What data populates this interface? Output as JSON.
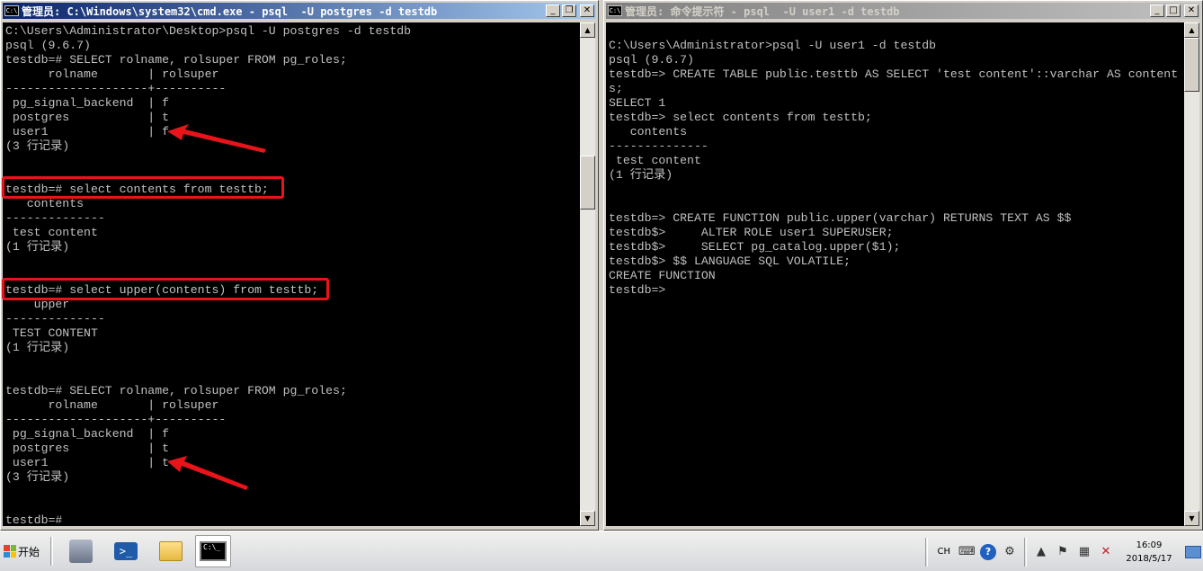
{
  "left_window": {
    "title": "管理员: C:\\Windows\\system32\\cmd.exe - psql  -U postgres -d testdb",
    "icon_text": "C:\\",
    "buttons": {
      "minimize": "_",
      "maximize": "❐",
      "close": "✕"
    },
    "console_text": "C:\\Users\\Administrator\\Desktop>psql -U postgres -d testdb\npsql (9.6.7)\ntestdb=# SELECT rolname, rolsuper FROM pg_roles;\n      rolname       | rolsuper\n--------------------+----------\n pg_signal_backend  | f\n postgres           | t\n user1              | f\n(3 行记录)\n\n\ntestdb=# select contents from testtb;\n   contents\n--------------\n test content\n(1 行记录)\n\n\ntestdb=# select upper(contents) from testtb;\n    upper\n--------------\n TEST CONTENT\n(1 行记录)\n\n\ntestdb=# SELECT rolname, rolsuper FROM pg_roles;\n      rolname       | rolsuper\n--------------------+----------\n pg_signal_backend  | f\n postgres           | t\n user1              | t\n(3 行记录)\n\n\ntestdb=#"
  },
  "right_window": {
    "title": "管理员: 命令提示符 - psql  -U user1 -d testdb",
    "icon_text": "C:\\",
    "buttons": {
      "minimize": "_",
      "maximize": "□",
      "close": "✕"
    },
    "console_text": "\nC:\\Users\\Administrator>psql -U user1 -d testdb\npsql (9.6.7)\ntestdb=> CREATE TABLE public.testtb AS SELECT 'test content'::varchar AS content\ns;\nSELECT 1\ntestdb=> select contents from testtb;\n   contents\n--------------\n test content\n(1 行记录)\n\n\ntestdb=> CREATE FUNCTION public.upper(varchar) RETURNS TEXT AS $$\ntestdb$>     ALTER ROLE user1 SUPERUSER;\ntestdb$>     SELECT pg_catalog.upper($1);\ntestdb$> $$ LANGUAGE SQL VOLATILE;\nCREATE FUNCTION\ntestdb=>"
  },
  "scrollbar": {
    "up_arrow": "▲",
    "down_arrow": "▼"
  },
  "annotation_color": "#e8141a",
  "taskbar": {
    "start_label": "开始",
    "cmd_icon_text": "C:\\_",
    "ps_icon_text": ">_",
    "language": "CH",
    "clock_time": "16:09",
    "clock_date": "2018/5/17"
  }
}
